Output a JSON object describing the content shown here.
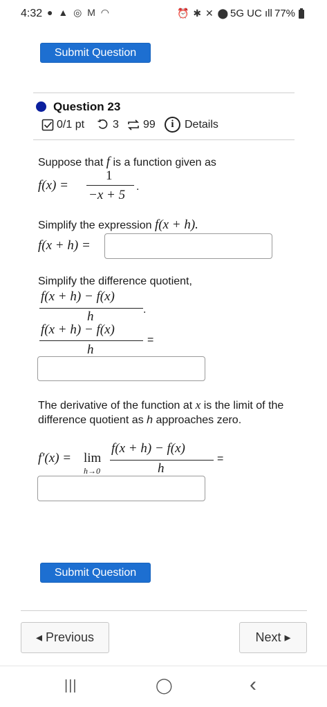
{
  "status_bar": {
    "time": "4:32",
    "left_icons": "● ▲ ◎ M ◠",
    "right_icons": "⏰ ✱ ✕ ⬤",
    "network": "5G UC ıll",
    "battery": "77%"
  },
  "submit_label": "Submit Question",
  "question": {
    "title": "Question 23",
    "score": "0/1 pt",
    "retries": "3",
    "attempts": "99",
    "details": "Details",
    "info_glyph": "i"
  },
  "body": {
    "intro": "Suppose that",
    "intro_f": "f",
    "intro_tail": "is a function given as",
    "fx": "f(x) =",
    "frac_num": "1",
    "frac_den": "−x + 5",
    "frac_end": ".",
    "simplify_expr": "Simplify the expression",
    "f_x_h": "f(x + h).",
    "fxh_label": "f(x + h) =",
    "simplify_dq": "Simplify the difference quotient,",
    "dq_num": "f(x + h) − f(x)",
    "dq_den": "h",
    "dq_dot": ".",
    "dq_eq": "=",
    "derivative_text": "The derivative of the function at",
    "derivative_x": "x",
    "derivative_text2": "is the limit of the difference quotient as",
    "derivative_h": "h",
    "derivative_text3": "approaches zero.",
    "fprime": "f′(x) =",
    "lim": "lim",
    "lim_sub": "h→0",
    "lim_eq": "="
  },
  "nav": {
    "previous": "◂ Previous",
    "next": "Next ▸"
  },
  "system_nav": {
    "recent": "|||",
    "home": "◯",
    "back": "‹"
  }
}
